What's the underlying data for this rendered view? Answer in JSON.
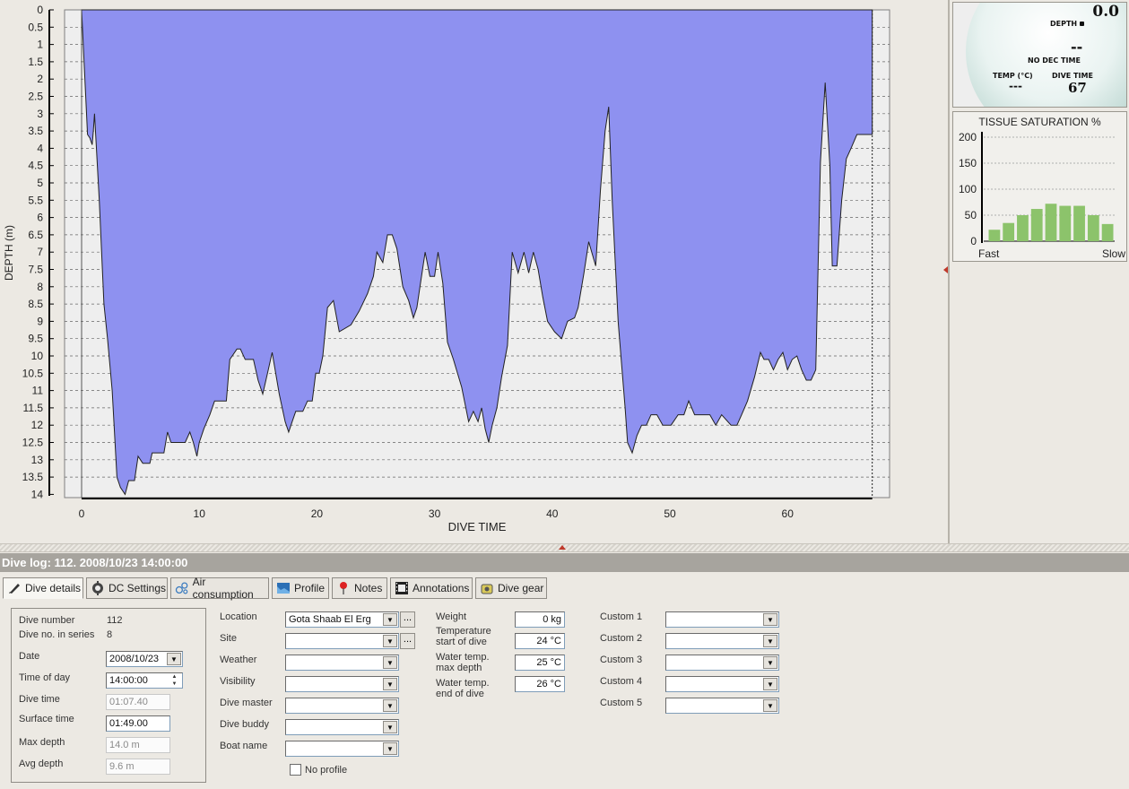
{
  "chart_data": {
    "type": "area",
    "xlabel": "DIVE TIME",
    "ylabel": "DEPTH (m)",
    "xlim": [
      0,
      68
    ],
    "ylim": [
      0,
      14
    ],
    "y_inverted": true,
    "x_ticks": [
      "0",
      "10",
      "20",
      "30",
      "40",
      "50",
      "60"
    ],
    "y_ticks": [
      "0",
      "0.5",
      "1",
      "1.5",
      "2",
      "2.5",
      "3",
      "3.5",
      "4",
      "4.5",
      "5",
      "5.5",
      "6",
      "6.5",
      "7",
      "7.5",
      "8",
      "8.5",
      "9",
      "9.5",
      "10",
      "10.5",
      "11",
      "11.5",
      "12",
      "12.5",
      "13",
      "13.5",
      "14"
    ],
    "fill_color": "#8e91f0",
    "series": [
      {
        "x": [
          0,
          0.5,
          0.7,
          0.9,
          1.0,
          1.1,
          1.5,
          1.9,
          2.2,
          2.6,
          3.0,
          3.3,
          3.7,
          4.0,
          4.5,
          4.8,
          5.2,
          5.8,
          6.0,
          7.0,
          7.3,
          7.6,
          8.0,
          8.4,
          8.8,
          9.2,
          9.5,
          9.8,
          10.0,
          10.4,
          10.9,
          11.3,
          11.9,
          12.3,
          12.6,
          13.2,
          13.5,
          13.9,
          14.2,
          14.6,
          15.0,
          15.4,
          15.8,
          16.2,
          16.8,
          17.3,
          17.6,
          17.9,
          18.2,
          18.8,
          19.2,
          19.6,
          19.9,
          20.2,
          20.5,
          20.9,
          21.4,
          21.9,
          22.9,
          23.6,
          24.3,
          24.8,
          25.1,
          25.6,
          26.0,
          26.4,
          26.8,
          27.3,
          27.8,
          28.2,
          28.5,
          28.8,
          29.2,
          29.6,
          30.0,
          30.3,
          30.7,
          31.1,
          31.6,
          32.3,
          32.9,
          33.3,
          33.7,
          34.0,
          34.3,
          34.6,
          34.9,
          35.3,
          35.7,
          36.2,
          36.6,
          37.1,
          37.6,
          38.0,
          38.4,
          38.8,
          39.2,
          39.6,
          40.2,
          40.8,
          41.3,
          41.9,
          42.2,
          42.7,
          43.1,
          43.7,
          44.1,
          44.5,
          44.8,
          45.1,
          45.6,
          46.2,
          46.4,
          46.8,
          47.2,
          47.6,
          48.0,
          48.4,
          48.9,
          49.4,
          50.1,
          50.7,
          51.2,
          51.6,
          52.1,
          52.6,
          53.1,
          53.4,
          53.9,
          54.4,
          55.2,
          55.7,
          56.1,
          56.6,
          57.2,
          57.7,
          58.0,
          58.4,
          58.8,
          59.2,
          59.6,
          60.0,
          60.4,
          60.8,
          61.2,
          61.6,
          62.0,
          62.4,
          62.8,
          63.2,
          63.6,
          63.8,
          64.2,
          64.6,
          65.0,
          65.4,
          65.9,
          66.3,
          67.2
        ],
        "y": [
          0,
          3.6,
          3.7,
          3.9,
          3.5,
          3.0,
          5.5,
          8.5,
          9.5,
          11.0,
          13.5,
          13.8,
          14.0,
          13.6,
          13.6,
          12.9,
          13.1,
          13.1,
          12.8,
          12.8,
          12.2,
          12.5,
          12.5,
          12.5,
          12.5,
          12.2,
          12.5,
          12.9,
          12.5,
          12.1,
          11.7,
          11.3,
          11.3,
          11.3,
          10.1,
          9.8,
          9.8,
          10.1,
          10.1,
          10.1,
          10.7,
          11.1,
          10.5,
          9.9,
          11.1,
          11.9,
          12.2,
          11.9,
          11.6,
          11.6,
          11.3,
          11.3,
          10.5,
          10.5,
          10.0,
          8.6,
          8.4,
          9.3,
          9.1,
          8.7,
          8.2,
          7.7,
          7.0,
          7.3,
          6.5,
          6.5,
          6.9,
          8.0,
          8.4,
          8.9,
          8.6,
          7.9,
          7.0,
          7.7,
          7.7,
          7.0,
          7.9,
          9.6,
          10.1,
          10.9,
          11.9,
          11.6,
          11.9,
          11.5,
          12.1,
          12.5,
          12.0,
          11.5,
          10.6,
          9.7,
          7.0,
          7.6,
          7.0,
          7.6,
          7.0,
          7.5,
          8.3,
          9.0,
          9.3,
          9.5,
          9.0,
          8.9,
          8.6,
          7.6,
          6.7,
          7.4,
          5.2,
          3.5,
          2.8,
          5.5,
          9.0,
          11.5,
          12.5,
          12.8,
          12.3,
          12.0,
          12.0,
          11.7,
          11.7,
          12.0,
          12.0,
          11.7,
          11.7,
          11.3,
          11.7,
          11.7,
          11.7,
          11.7,
          12.0,
          11.7,
          12.0,
          12.0,
          11.7,
          11.3,
          10.6,
          9.9,
          10.1,
          10.1,
          10.4,
          10.1,
          9.9,
          10.4,
          10.1,
          10.0,
          10.4,
          10.7,
          10.7,
          10.4,
          4.4,
          2.1,
          4.5,
          7.4,
          7.4,
          5.5,
          4.3,
          4.0,
          3.6,
          3.6,
          3.6
        ]
      }
    ]
  },
  "gauge": {
    "depth_value": "0.0",
    "depth_label": "DEPTH",
    "dec_value": "--",
    "dec_label": "NO DEC TIME",
    "temp_label": "TEMP (°C)",
    "temp_value": "---",
    "divetime_label": "DIVE TIME",
    "divetime_value": "67"
  },
  "tissue": {
    "title": "TISSUE SATURATION %",
    "y_ticks": [
      "200",
      "150",
      "100",
      "50",
      "0"
    ],
    "ymax": 200,
    "values": [
      22,
      35,
      50,
      62,
      72,
      68,
      68,
      50,
      33
    ],
    "left_label": "Fast",
    "right_label": "Slow",
    "bar_color": "#8cc36b"
  },
  "log_header": "Dive log: 112. 2008/10/23 14:00:00",
  "tabs": [
    {
      "label": "Dive details",
      "icon": "pen-icon"
    },
    {
      "label": "DC Settings",
      "icon": "gear-icon"
    },
    {
      "label": "Air consumption",
      "icon": "bubbles-icon"
    },
    {
      "label": "Profile",
      "icon": "profile-icon"
    },
    {
      "label": "Notes",
      "icon": "pin-icon"
    },
    {
      "label": "Annotations",
      "icon": "film-icon"
    },
    {
      "label": "Dive gear",
      "icon": "gear-bag-icon"
    }
  ],
  "details": {
    "dive_number_label": "Dive number",
    "dive_number": "112",
    "series_label": "Dive no. in series",
    "series": "8",
    "date_label": "Date",
    "date": "2008/10/23",
    "time_label": "Time of day",
    "time": "14:00:00",
    "divetime_label": "Dive time",
    "divetime": "01:07.40",
    "surface_label": "Surface time",
    "surface": "01:49.00",
    "maxdepth_label": "Max depth",
    "maxdepth": "14.0 m",
    "avgdepth_label": "Avg depth",
    "avgdepth": "9.6 m"
  },
  "place": {
    "location_label": "Location",
    "location": "Gota Shaab El Erg",
    "site_label": "Site",
    "weather_label": "Weather",
    "visibility_label": "Visibility",
    "divemaster_label": "Dive master",
    "buddy_label": "Dive buddy",
    "boat_label": "Boat name",
    "noprofile_label": "No profile"
  },
  "env": {
    "weight_label": "Weight",
    "weight": "0 kg",
    "temp_start_label1": "Temperature",
    "temp_start_label2": "start of dive",
    "temp_start": "24 °C",
    "temp_max_label1": "Water temp.",
    "temp_max_label2": "max depth",
    "temp_max": "25 °C",
    "temp_end_label1": "Water temp.",
    "temp_end_label2": "end of dive",
    "temp_end": "26 °C"
  },
  "custom": {
    "c1": "Custom 1",
    "c2": "Custom 2",
    "c3": "Custom 3",
    "c4": "Custom 4",
    "c5": "Custom 5"
  }
}
